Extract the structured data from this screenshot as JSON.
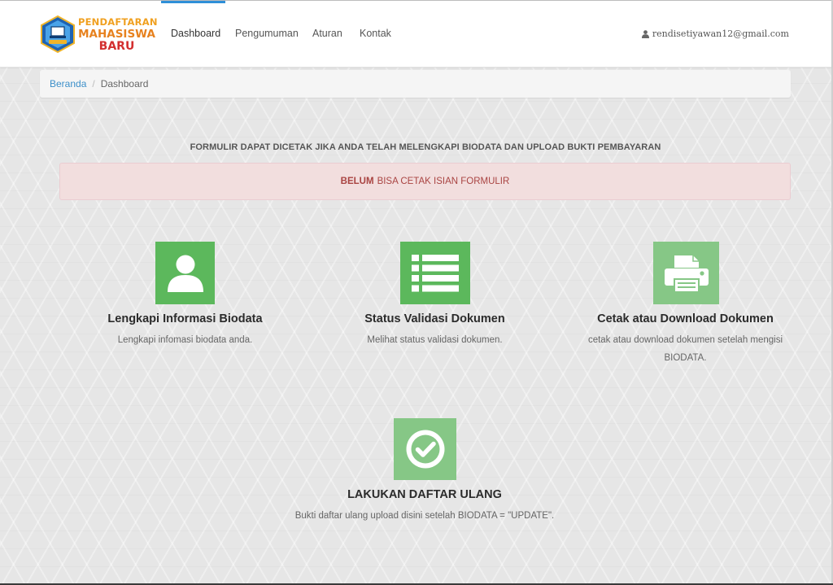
{
  "brand": {
    "line1": "PENDAFTARAN",
    "line2": "MAHASISWA",
    "line3": "BARU",
    "colors": {
      "line1": "#f0a020",
      "line2": "#e7821f",
      "line3": "#d32f2f"
    }
  },
  "nav": {
    "items": [
      {
        "label": "Dashboard",
        "active": true
      },
      {
        "label": "Pengumuman"
      },
      {
        "label": "Aturan"
      },
      {
        "label": "Kontak"
      }
    ],
    "user_email": "rendisetiyawan12@gmail.com",
    "user_icon": "user-icon",
    "accent": "#2f8fd8"
  },
  "breadcrumb": {
    "home": "Beranda",
    "separator": "/",
    "current": "Dashboard"
  },
  "notice": {
    "title": "FORMULIR DAPAT DICETAK JIKA ANDA TELAH MELENGKAPI BIODATA DAN UPLOAD BUKTI PEMBAYARAN",
    "alert_strong": "BELUM",
    "alert_text": "BISA CETAK ISIAN FORMULIR"
  },
  "features": [
    {
      "icon": "user-icon",
      "title": "Lengkapi Informasi Biodata",
      "desc": "Lengkapi infomasi biodata anda.",
      "color": "#5cb85c"
    },
    {
      "icon": "list-icon",
      "title": "Status Validasi Dokumen",
      "desc": "Melihat status validasi dokumen.",
      "color": "#5cb85c"
    },
    {
      "icon": "print-icon",
      "title": "Cetak atau Download Dokumen",
      "desc": "cetak atau download dokumen setelah mengisi BIODATA.",
      "color": "#86c786"
    },
    {
      "icon": "check-circle-icon",
      "title": "LAKUKAN DAFTAR ULANG",
      "desc": "Bukti daftar ulang upload disini setelah BIODATA = \"UPDATE\".",
      "color": "#86c786"
    }
  ]
}
